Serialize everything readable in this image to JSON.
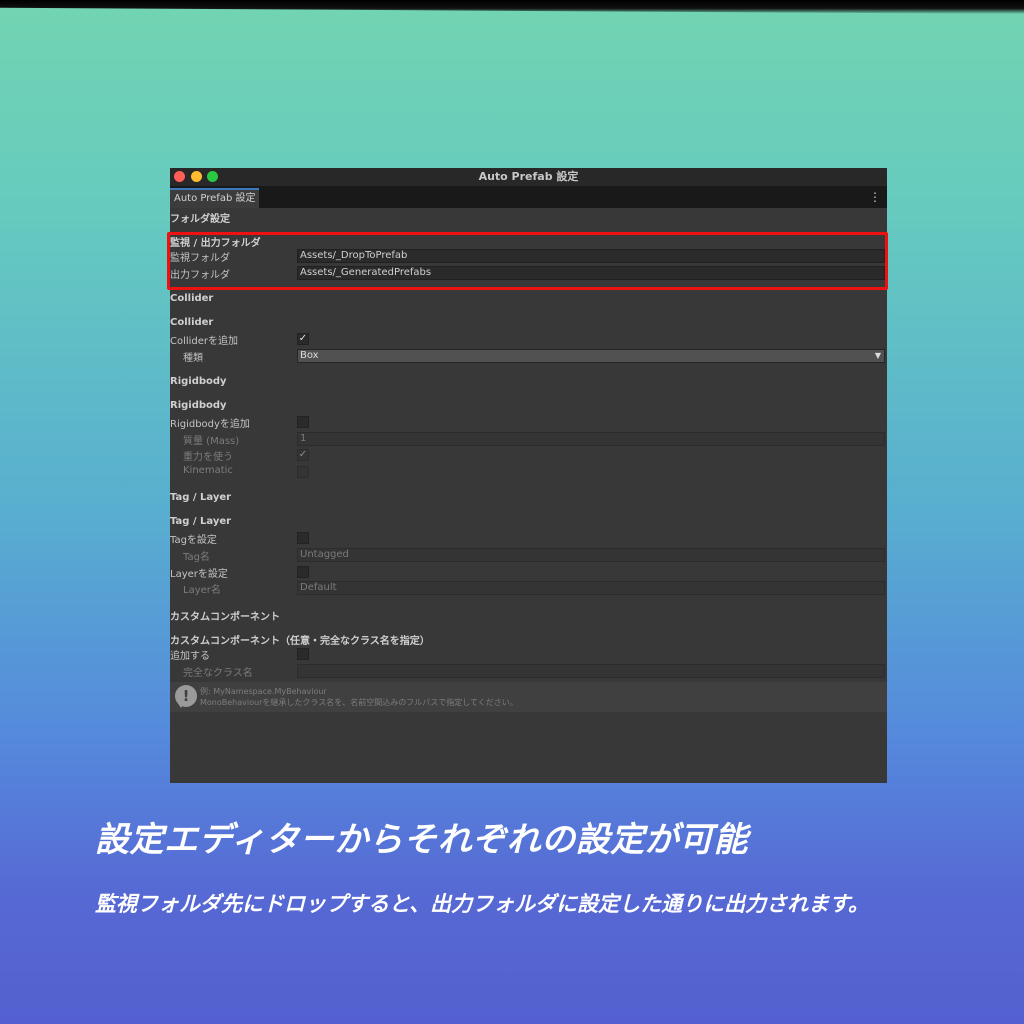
{
  "window": {
    "title": "Auto Prefab 設定",
    "tab_label": "Auto Prefab 設定",
    "menu_glyph": "⋮"
  },
  "folder": {
    "section": "フォルダ設定",
    "group": "監視 / 出力フォルダ",
    "watch_label": "監視フォルダ",
    "watch_value": "Assets/_DropToPrefab",
    "output_label": "出力フォルダ",
    "output_value": "Assets/_GeneratedPrefabs"
  },
  "collider": {
    "section": "Collider",
    "group": "Collider",
    "add_label": "Colliderを追加",
    "add_checked": true,
    "type_label": "種類",
    "type_value": "Box"
  },
  "rigidbody": {
    "section": "Rigidbody",
    "group": "Rigidbody",
    "add_label": "Rigidbodyを追加",
    "add_checked": false,
    "mass_label": "質量 (Mass)",
    "mass_value": "1",
    "gravity_label": "重力を使う",
    "gravity_checked": true,
    "kinematic_label": "Kinematic",
    "kinematic_checked": false
  },
  "tag_layer": {
    "section": "Tag / Layer",
    "group": "Tag / Layer",
    "tag_set_label": "Tagを設定",
    "tag_name_label": "Tag名",
    "tag_name_value": "Untagged",
    "layer_set_label": "Layerを設定",
    "layer_name_label": "Layer名",
    "layer_name_value": "Default"
  },
  "custom": {
    "section": "カスタムコンポーネント",
    "group": "カスタムコンポーネント（任意・完全なクラス名を指定）",
    "add_label": "追加する",
    "class_label": "完全なクラス名",
    "class_value": "",
    "help_line1": "例: MyNamespace.MyBehaviour",
    "help_line2": "MonoBehaviourを継承したクラス名を、名前空間込みのフルパスで指定してください。"
  },
  "glyphs": {
    "check": "✓",
    "caret": "▼",
    "help": "!"
  },
  "captions": {
    "main": "設定エディターからそれぞれの設定が可能",
    "sub": "監視フォルダ先にドロップすると、出力フォルダに設定した通りに出力されます。"
  },
  "colors": {
    "highlight": "#ee1111",
    "window_bg": "#383838",
    "tab_accent": "#3a79bb"
  }
}
